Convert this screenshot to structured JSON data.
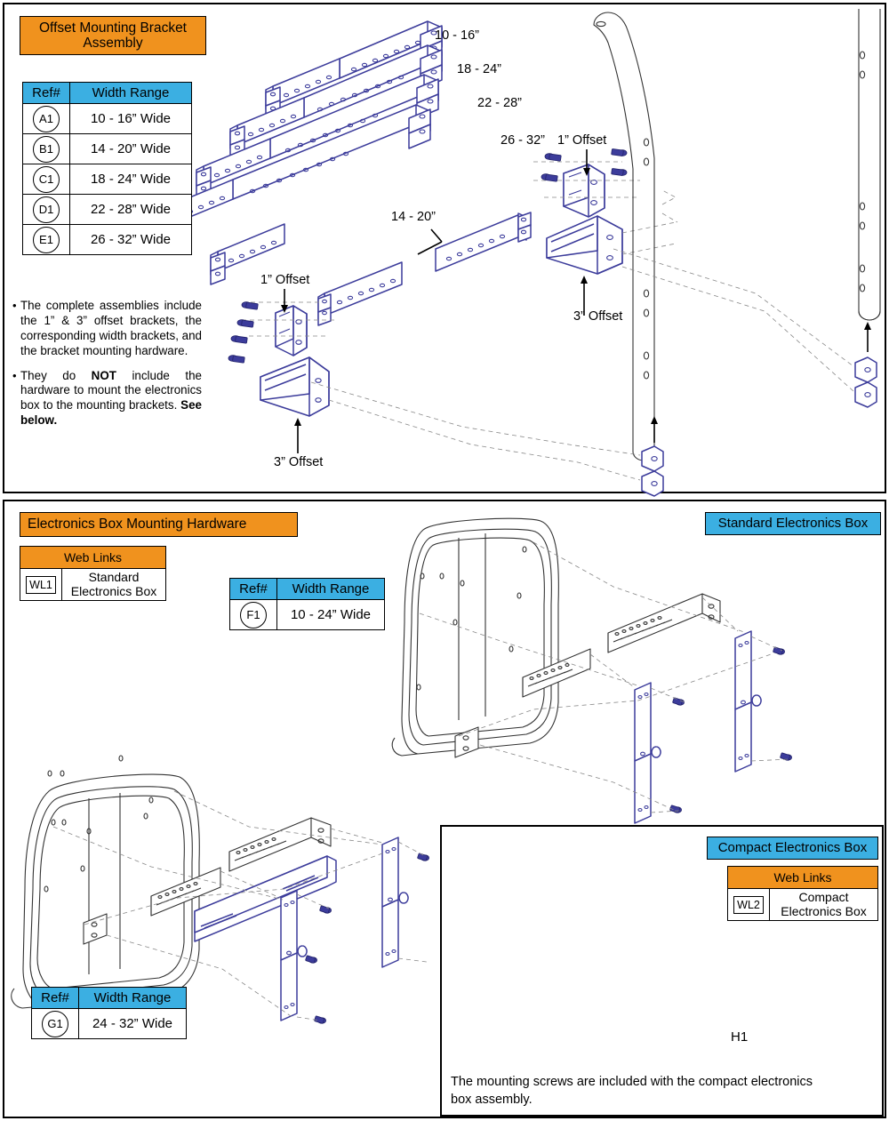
{
  "top_panel": {
    "banner": "Offset Mounting Bracket Assembly",
    "table": {
      "headers": [
        "Ref#",
        "Width Range"
      ],
      "rows": [
        {
          "ref": "A1",
          "width": "10 - 16” Wide"
        },
        {
          "ref": "B1",
          "width": "14 - 20” Wide"
        },
        {
          "ref": "C1",
          "width": "18 - 24” Wide"
        },
        {
          "ref": "D1",
          "width": "22 - 28” Wide"
        },
        {
          "ref": "E1",
          "width": "26 - 32” Wide"
        }
      ]
    },
    "notes": [
      {
        "bullet": "•",
        "text": "The complete assemblies include the 1” & 3” offset brackets, the corresponding width brackets, and the bracket mounting hardware."
      },
      {
        "bullet": "•",
        "text_pre": "They do ",
        "text_bold": "NOT",
        "text_mid": " include the hardware to mount the electronics box to the mounting brackets. ",
        "text_bold2": "See below."
      }
    ],
    "labels": {
      "w10_16": "10 - 16”",
      "w18_24": "18 - 24”",
      "w22_28": "22 - 28”",
      "w26_32": "26 - 32”",
      "w14_20": "14 - 20”",
      "offset1_right": "1” Offset",
      "offset1_left": "1” Offset",
      "offset3_right": "3” Offset",
      "offset3_left": "3” Offset"
    }
  },
  "bottom_panel": {
    "banner": "Electronics Box Mounting Hardware",
    "standard_banner": "Standard Electronics Box",
    "web_links_standard": {
      "header": "Web Links",
      "code": "WL1",
      "label": "Standard Electronics Box"
    },
    "table_f1": {
      "headers": [
        "Ref#",
        "Width Range"
      ],
      "rows": [
        {
          "ref": "F1",
          "width": "10 - 24” Wide"
        }
      ]
    },
    "table_g1": {
      "headers": [
        "Ref#",
        "Width Range"
      ],
      "rows": [
        {
          "ref": "G1",
          "width": "24 - 32” Wide"
        }
      ]
    }
  },
  "compact_panel": {
    "banner": "Compact Electronics Box",
    "web_links": {
      "header": "Web Links",
      "code": "WL2",
      "label": "Compact Electronics Box"
    },
    "callout": "H1",
    "caption": "The mounting screws are included with the compact electronics box assembly."
  },
  "colors": {
    "orange": "#F0921E",
    "blue": "#3BAFE2",
    "drawing_blue": "#3C3C9B",
    "drawing_gray": "#333333"
  }
}
